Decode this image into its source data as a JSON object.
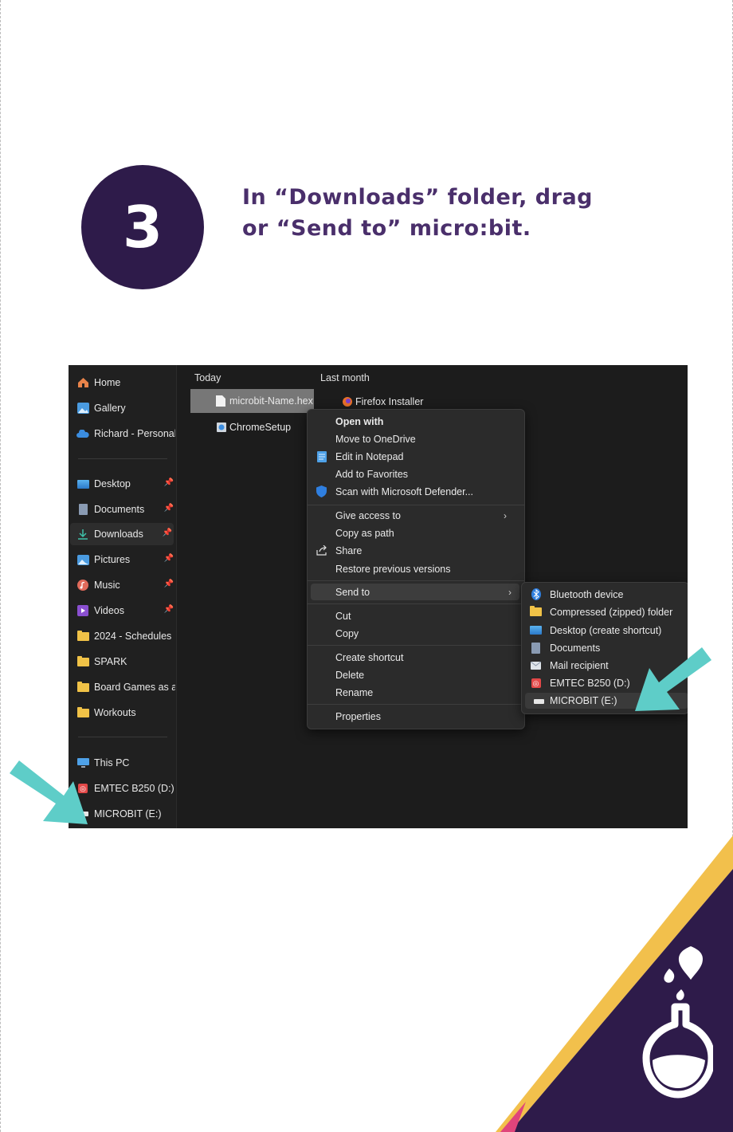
{
  "step": {
    "number": "3",
    "instruction_line1": "In “Downloads” folder, drag",
    "instruction_line2": "or “Send to” micro:bit."
  },
  "sidebar": {
    "items": [
      {
        "label": "Home"
      },
      {
        "label": "Gallery"
      },
      {
        "label": "Richard - Personal"
      },
      {
        "label": "Desktop"
      },
      {
        "label": "Documents"
      },
      {
        "label": "Downloads"
      },
      {
        "label": "Pictures"
      },
      {
        "label": "Music"
      },
      {
        "label": "Videos"
      },
      {
        "label": "2024 - Schedules"
      },
      {
        "label": "SPARK"
      },
      {
        "label": "Board Games as an"
      },
      {
        "label": "Workouts"
      },
      {
        "label": "This PC"
      },
      {
        "label": "EMTEC B250 (D:)"
      },
      {
        "label": "MICROBIT (E:)"
      }
    ]
  },
  "files": {
    "group_today": "Today",
    "group_last_month": "Last month",
    "items": [
      {
        "label": "microbit-Name.hex"
      },
      {
        "label": "ChromeSetup"
      },
      {
        "label": "Firefox Installer"
      }
    ]
  },
  "context_menu": {
    "items": [
      {
        "label": "Open with"
      },
      {
        "label": "Move to OneDrive"
      },
      {
        "label": "Edit in Notepad"
      },
      {
        "label": "Add to Favorites"
      },
      {
        "label": "Scan with Microsoft Defender..."
      },
      {
        "label": "Give access to"
      },
      {
        "label": "Copy as path"
      },
      {
        "label": "Share"
      },
      {
        "label": "Restore previous versions"
      },
      {
        "label": "Send to"
      },
      {
        "label": "Cut"
      },
      {
        "label": "Copy"
      },
      {
        "label": "Create shortcut"
      },
      {
        "label": "Delete"
      },
      {
        "label": "Rename"
      },
      {
        "label": "Properties"
      }
    ]
  },
  "send_to_menu": {
    "items": [
      {
        "label": "Bluetooth device"
      },
      {
        "label": "Compressed (zipped) folder"
      },
      {
        "label": "Desktop (create shortcut)"
      },
      {
        "label": "Documents"
      },
      {
        "label": "Mail recipient"
      },
      {
        "label": "EMTEC B250 (D:)"
      },
      {
        "label": "MICROBIT (E:)"
      }
    ]
  },
  "colors": {
    "brand_purple": "#2e1b4a",
    "heading_purple": "#4a2f6b",
    "arrow_teal": "#5ecdc8",
    "accent_yellow": "#f2c04c",
    "accent_pink": "#e0457b"
  }
}
